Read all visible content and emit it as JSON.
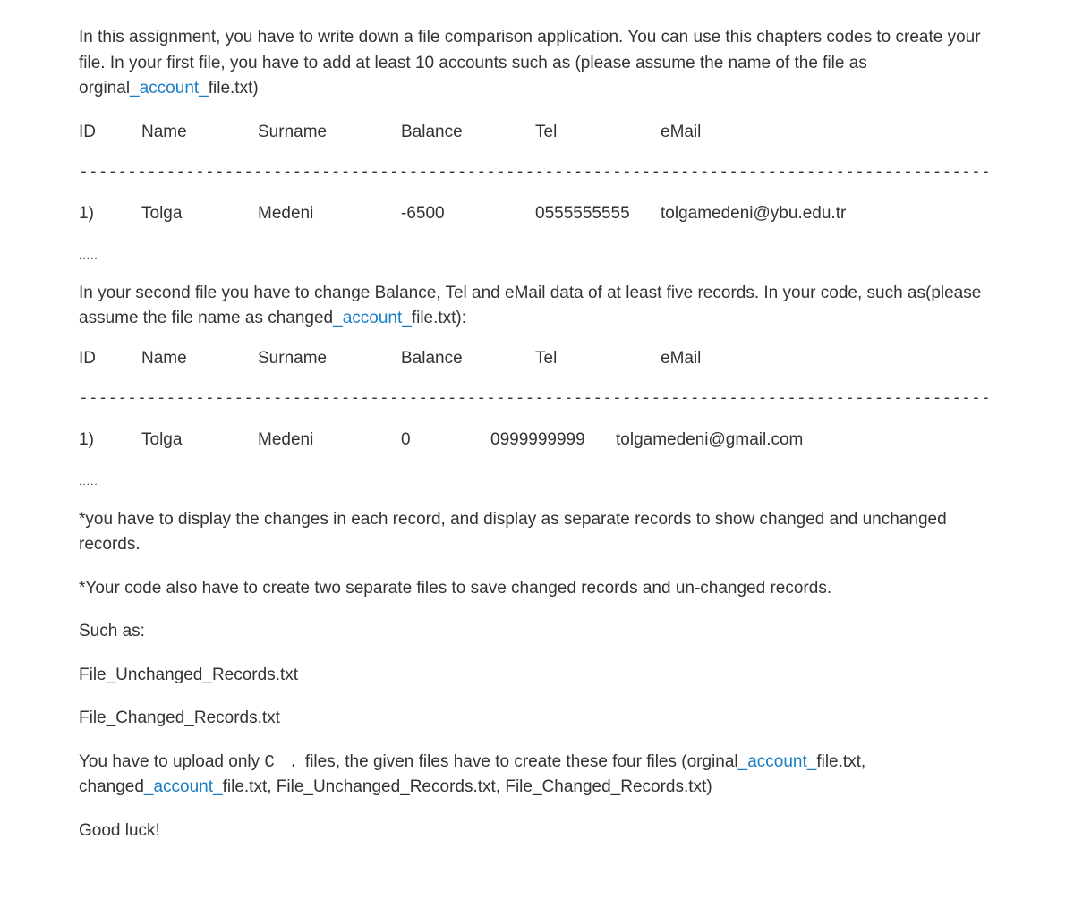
{
  "intro": {
    "text_before_link": "In this assignment, you have to write down a file comparison application. You can use this chapters codes to create your file. In your first file, you have to add at least 10 accounts such as (please assume the name of the file as orginal",
    "link_text": "_account_",
    "text_after_link": "file.txt)"
  },
  "headers": {
    "id": "ID",
    "name": "Name",
    "surname": "Surname",
    "balance": "Balance",
    "tel": "Tel",
    "email": "eMail"
  },
  "dashed": "----------------------------------------------------------------------------------------------",
  "row1": {
    "id": "1)",
    "name": "Tolga",
    "surname": "Medeni",
    "balance": "-6500",
    "tel": "0555555555",
    "email": "tolgamedeni@ybu.edu.tr"
  },
  "dots": ".....",
  "para2": {
    "text_before_link": "In your second file you have to change Balance, Tel and eMail data of at least five records. In your code, such as(please assume the file name as changed",
    "link_text": "_account_",
    "text_after_link": "file.txt):"
  },
  "row2": {
    "id": "1)",
    "name": "Tolga",
    "surname": "Medeni",
    "balance": "0",
    "tel": "0999999999",
    "email": "tolgamedeni@gmail.com"
  },
  "note1": "*you have to display the changes in each record, and display as separate records to show changed and unchanged records.",
  "note2": "*Your code also have to create two separate files to save changed records and un-changed records.",
  "suchas": "Such as:",
  "file1": "File_Unchanged_Records.txt",
  "file2": "File_Changed_Records.txt",
  "upload": {
    "p1": "You have to upload only ",
    "code": " C .",
    "p2": " files, the given files have to create these four files (orginal",
    "link1": "_account_",
    "p3": "file.txt, changed",
    "link2": "_account_",
    "p4": "file.txt, File_Unchanged_Records.txt, File_Changed_Records.txt)"
  },
  "goodluck": "Good luck!"
}
